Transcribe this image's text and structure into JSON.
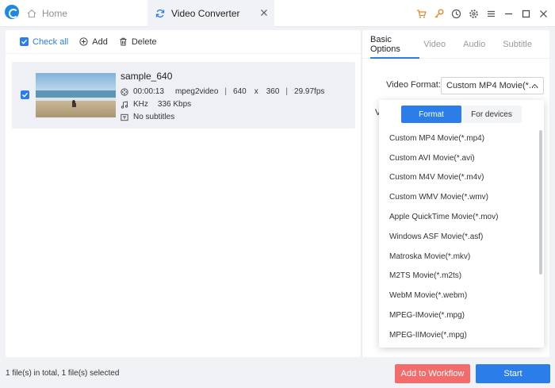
{
  "titlebar": {
    "home_tab": "Home",
    "active_tab": "Video Converter",
    "icons": [
      "cart-icon",
      "key-icon",
      "clock-icon",
      "gear-icon",
      "menu-icon",
      "minimize-icon",
      "maximize-icon",
      "close-icon"
    ]
  },
  "toolbar": {
    "check_all": "Check all",
    "add": "Add",
    "delete": "Delete"
  },
  "file": {
    "name": "sample_640",
    "duration": "00:00:13",
    "codec": "mpeg2video",
    "width": "640",
    "x": "x",
    "height": "360",
    "fps": "29.97fps",
    "audio_rate": "KHz",
    "bitrate": "336 Kbps",
    "subtitles": "No subtitles",
    "sep": "|"
  },
  "options": {
    "tabs": [
      "Basic Options",
      "Video",
      "Audio",
      "Subtitle"
    ],
    "format_label": "Video Format:",
    "format_value": "Custom MP4 Movie(*....",
    "partial_label": "V"
  },
  "dropdown": {
    "seg_format": "Format",
    "seg_devices": "For devices",
    "items": [
      "Custom MP4 Movie(*.mp4)",
      "Custom AVI Movie(*.avi)",
      "Custom M4V Movie(*.m4v)",
      "Custom WMV Movie(*.wmv)",
      "Apple QuickTime Movie(*.mov)",
      "Windows ASF Movie(*.asf)",
      "Matroska Movie(*.mkv)",
      "M2TS Movie(*.m2ts)",
      "WebM Movie(*.webm)",
      "MPEG-IMovie(*.mpg)",
      "MPEG-IIMovie(*.mpg)"
    ]
  },
  "footer": {
    "status": "1 file(s) in total, 1 file(s) selected",
    "workflow": "Add to Workflow",
    "start": "Start"
  },
  "colors": {
    "accent": "#2b7de9",
    "danger": "#f36b6b",
    "icon_orange": "#e8862c"
  }
}
